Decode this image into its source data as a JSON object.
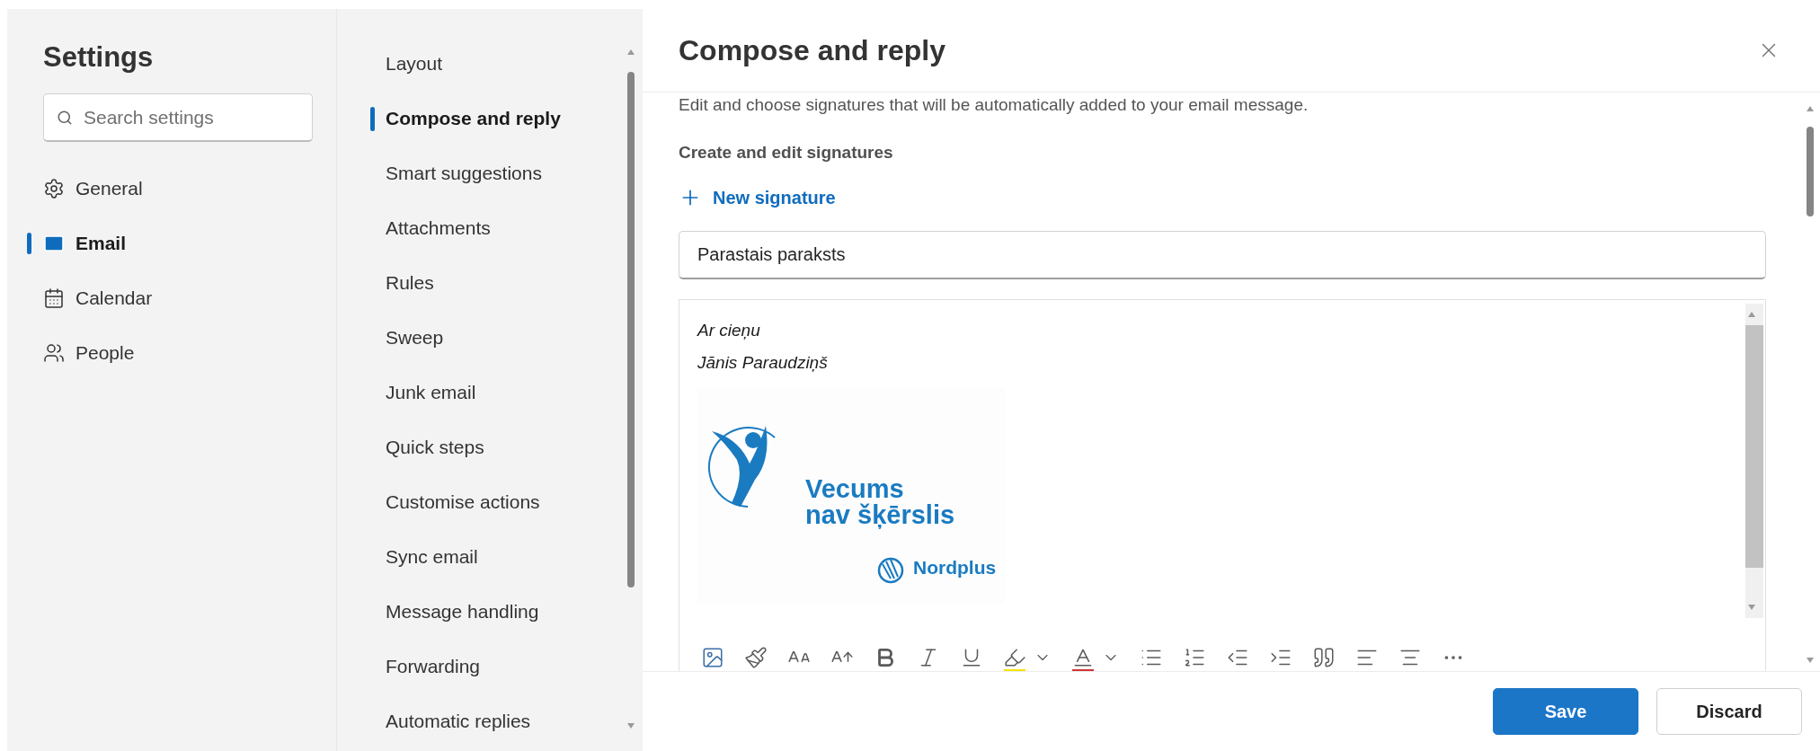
{
  "settings": {
    "title": "Settings",
    "search": {
      "placeholder": "Search settings"
    },
    "categories": [
      {
        "label": "General",
        "selected": false
      },
      {
        "label": "Email",
        "selected": true
      },
      {
        "label": "Calendar",
        "selected": false
      },
      {
        "label": "People",
        "selected": false
      }
    ]
  },
  "subnav": {
    "items": [
      {
        "label": "Layout",
        "selected": false
      },
      {
        "label": "Compose and reply",
        "selected": true
      },
      {
        "label": "Smart suggestions",
        "selected": false
      },
      {
        "label": "Attachments",
        "selected": false
      },
      {
        "label": "Rules",
        "selected": false
      },
      {
        "label": "Sweep",
        "selected": false
      },
      {
        "label": "Junk email",
        "selected": false
      },
      {
        "label": "Quick steps",
        "selected": false
      },
      {
        "label": "Customise actions",
        "selected": false
      },
      {
        "label": "Sync email",
        "selected": false
      },
      {
        "label": "Message handling",
        "selected": false
      },
      {
        "label": "Forwarding",
        "selected": false
      },
      {
        "label": "Automatic replies",
        "selected": false
      }
    ]
  },
  "panel": {
    "title": "Compose and reply",
    "description": "Edit and choose signatures that will be automatically added to your email message.",
    "section_heading": "Create and edit signatures",
    "new_signature": "New signature",
    "signature_name": "Parastais paraksts",
    "signature_lines": [
      "Ar cieņu",
      "Jānis Paraudziņš"
    ],
    "logo": {
      "line_1": "Vecums",
      "line_2": "nav šķērslis",
      "partner": "Nordplus"
    }
  },
  "buttons": [
    {
      "label": "Save",
      "kind": "primary"
    },
    {
      "label": "Discard",
      "kind": "secondary"
    }
  ]
}
